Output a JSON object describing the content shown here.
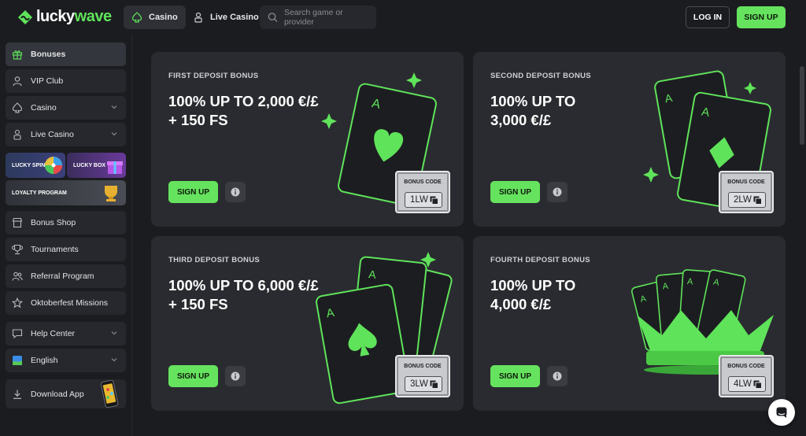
{
  "header": {
    "logo": {
      "part1": "lucky",
      "part2": "wave"
    },
    "tabs": [
      {
        "label": "Casino",
        "icon": "spade-icon",
        "active": true
      },
      {
        "label": "Live Casino",
        "icon": "dealer-icon",
        "active": false
      }
    ],
    "search_placeholder": "Search game or provider",
    "login_label": "LOG IN",
    "signup_label": "SIGN UP"
  },
  "sidebar": {
    "items": [
      {
        "label": "Bonuses",
        "icon": "gift-icon",
        "active": true
      },
      {
        "label": "VIP Club",
        "icon": "user-icon"
      },
      {
        "label": "Casino",
        "icon": "spade-icon",
        "expandable": true
      },
      {
        "label": "Live Casino",
        "icon": "dealer-icon",
        "expandable": true
      },
      {
        "label": "Bonus Shop",
        "icon": "shop-icon"
      },
      {
        "label": "Tournaments",
        "icon": "trophy-icon"
      },
      {
        "label": "Referral Program",
        "icon": "users-icon"
      },
      {
        "label": "Oktoberfest Missions",
        "icon": "star-icon"
      },
      {
        "label": "Help Center",
        "icon": "chat-icon",
        "expandable": true
      },
      {
        "label": "English",
        "icon": "globe-flag-icon",
        "expandable": true
      },
      {
        "label": "Download App",
        "icon": "download-icon"
      }
    ],
    "promos": {
      "lucky_spin": "LUCKY SPIN",
      "lucky_box": "LUCKY BOX",
      "loyalty": "LOYALTY PROGRAM"
    }
  },
  "cards": [
    {
      "label": "FIRST DEPOSIT BONUS",
      "title_l1": "100% UP TO 2,000 €/£",
      "title_l2": "+ 150 FS",
      "signup": "SIGN UP",
      "code_label": "BONUS CODE",
      "code": "1LW"
    },
    {
      "label": "SECOND DEPOSIT BONUS",
      "title_l1": "100% UP TO",
      "title_l2": "3,000 €/£",
      "signup": "SIGN UP",
      "code_label": "BONUS CODE",
      "code": "2LW"
    },
    {
      "label": "THIRD DEPOSIT BONUS",
      "title_l1": "100% UP TO 6,000 €/£",
      "title_l2": "+ 150 FS",
      "signup": "SIGN UP",
      "code_label": "BONUS CODE",
      "code": "3LW"
    },
    {
      "label": "FOURTH DEPOSIT BONUS",
      "title_l1": "100% UP TO",
      "title_l2": "4,000 €/£",
      "signup": "SIGN UP",
      "code_label": "BONUS CODE",
      "code": "4LW"
    }
  ],
  "colors": {
    "accent": "#66e35e",
    "bg": "#1b1c20",
    "card": "#2a2b30"
  }
}
